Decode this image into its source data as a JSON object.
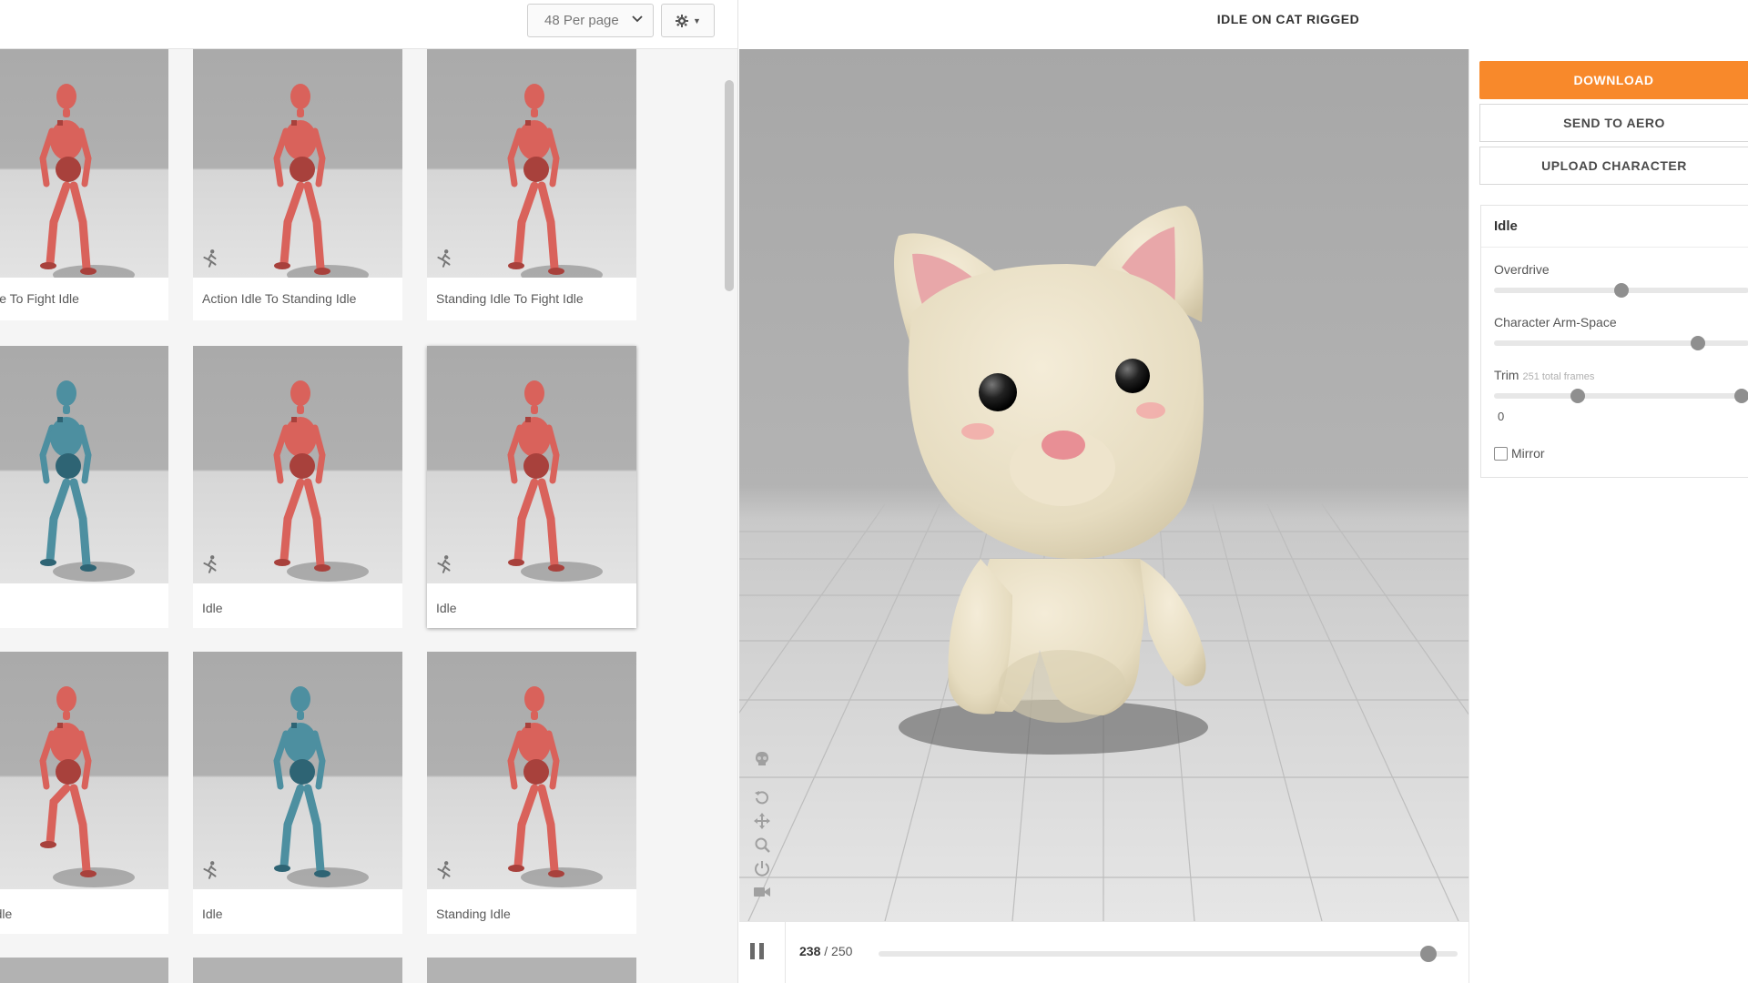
{
  "toolbar": {
    "per_page": "48 Per page",
    "settings_icon": "gear-icon"
  },
  "library": {
    "cards": [
      {
        "label": "on Idle To Fight Idle",
        "figure": "red"
      },
      {
        "label": "Action Idle To Standing Idle",
        "figure": "red"
      },
      {
        "label": "Standing Idle To Fight Idle",
        "figure": "red"
      },
      {
        "label": "",
        "figure": "blue"
      },
      {
        "label": "Idle",
        "figure": "red"
      },
      {
        "label": "Idle",
        "figure": "red",
        "selected": true
      },
      {
        "label": "ling Idle",
        "figure": "red"
      },
      {
        "label": "Idle",
        "figure": "blue"
      },
      {
        "label": "Standing Idle",
        "figure": "red"
      }
    ]
  },
  "viewer": {
    "title": "IDLE ON CAT RIGGED",
    "tools": [
      "skull-icon",
      "rotate-icon",
      "move-icon",
      "zoom-icon",
      "power-icon",
      "camera-icon"
    ]
  },
  "playback": {
    "current_frame": "238",
    "separator": " / ",
    "total_frames": "250",
    "progress": 0.95
  },
  "actions": {
    "download": "DOWNLOAD",
    "send_to_aero": "SEND TO AERO",
    "upload_character": "UPLOAD CHARACTER"
  },
  "settings": {
    "title": "Idle",
    "overdrive_label": "Overdrive",
    "overdrive_value": 0.5,
    "arm_space_label": "Character Arm-Space",
    "arm_space_value": 0.8,
    "trim_label": "Trim",
    "trim_note": "251 total frames",
    "trim_start": 0.33,
    "trim_end": 0.97,
    "trim_value": "0",
    "mirror_label": "Mirror",
    "mirror_checked": false
  },
  "colors": {
    "accent": "#f8892b",
    "figure_red": "#d9625b",
    "figure_blue": "#4d8fa0"
  }
}
